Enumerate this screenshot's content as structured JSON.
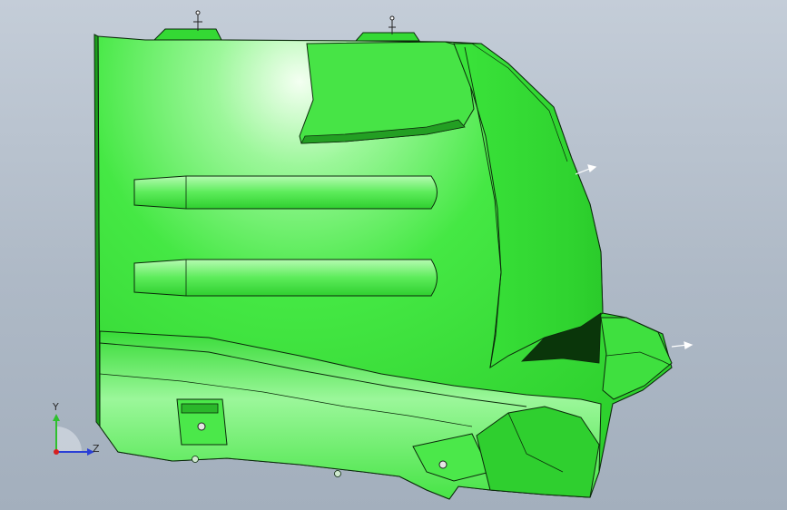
{
  "viewport": {
    "background_top": "#c4cdd8",
    "background_bottom": "#a3afbd"
  },
  "model": {
    "body_color": "#39e23a",
    "highlight_color": "#e6ffe4",
    "shadow_color": "#1fa61f",
    "edge_color": "#0b2a0b"
  },
  "triad": {
    "y_label": "Y",
    "z_label": "Z",
    "y_color": "#2ec02e",
    "z_color": "#2a3fd6",
    "x_color": "#d62020"
  }
}
